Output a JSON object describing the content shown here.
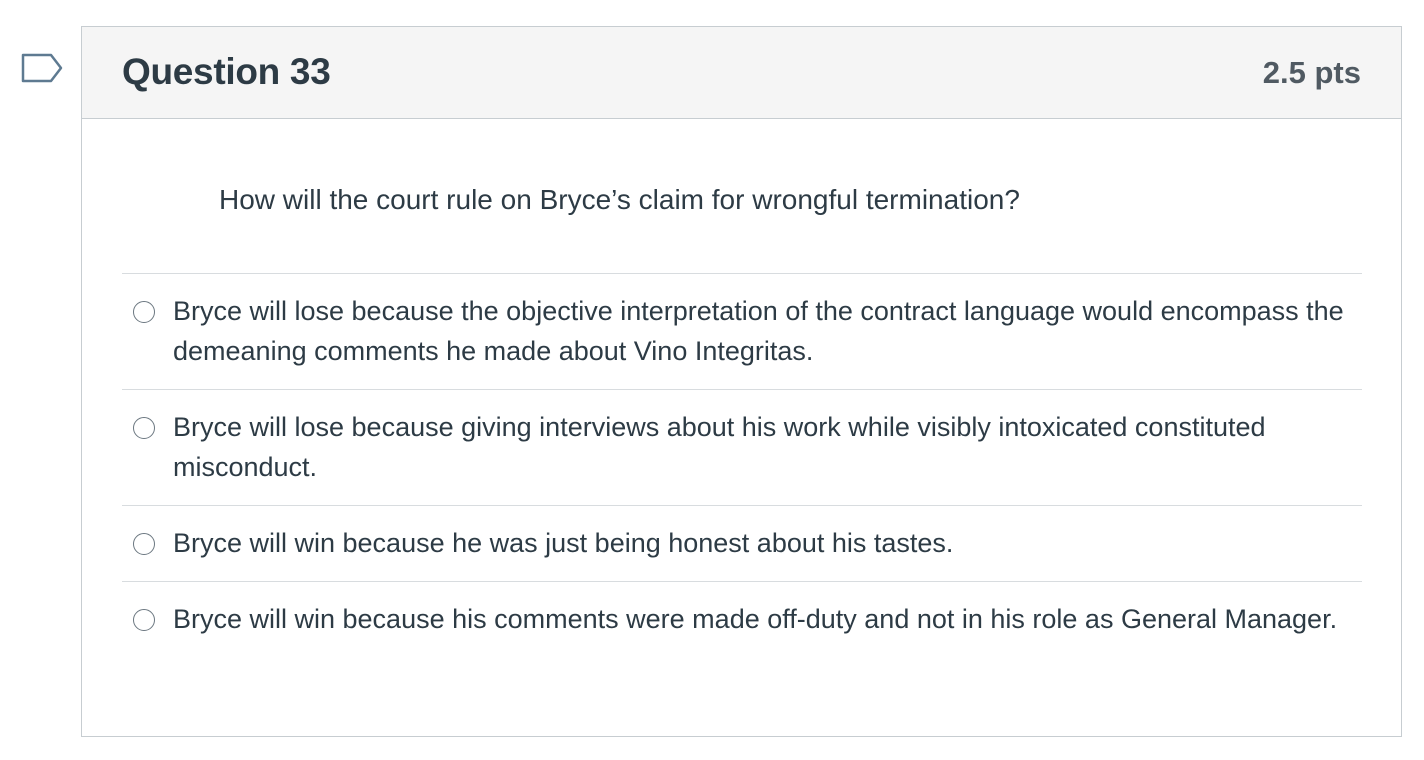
{
  "question": {
    "title": "Question 33",
    "points": "2.5 pts",
    "text": "How will the court rule on Bryce’s claim for wrongful termination?",
    "flag_icon": "bookmark-flag-icon",
    "answers": [
      {
        "label": "Bryce will lose because the objective interpretation of the contract language would encompass the demeaning comments he made about Vino Integritas.",
        "selected": false
      },
      {
        "label": "Bryce will lose because giving interviews about his work while visibly intoxicated constituted misconduct.",
        "selected": false
      },
      {
        "label": "Bryce will win because he was just being honest about his tastes.",
        "selected": false
      },
      {
        "label": "Bryce will win because his comments were made off-duty and not in his role as General Manager.",
        "selected": false
      }
    ]
  },
  "colors": {
    "header_bg": "#f5f5f5",
    "border": "#c7cdd1",
    "text": "#2d3b45",
    "flag_stroke": "#5e7a91"
  }
}
